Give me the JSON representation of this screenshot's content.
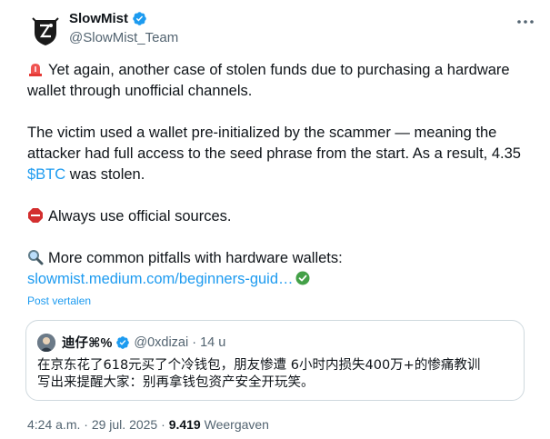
{
  "author": {
    "name": "SlowMist",
    "handle": "@SlowMist_Team"
  },
  "tweet": {
    "line1": "Yet again, another case of stolen funds due to purchasing a hardware wallet through unofficial channels.",
    "line2_pre": "The victim used a wallet pre-initialized by the scammer — meaning the attacker had full access to the seed phrase from the start. As a result, 4.35 ",
    "cashtag": "$BTC",
    "line2_post": " was stolen.",
    "line3": "Always use official sources.",
    "line4": "More common pitfalls with hardware wallets:",
    "link": "slowmist.medium.com/beginners-guid…"
  },
  "translate_label": "Post vertalen",
  "quote": {
    "name": "迪仔⌘%",
    "handle": "@0xdizai",
    "separator": "·",
    "time": "14 u",
    "text_line1": "在京东花了618元买了个冷钱包，朋友惨遭 6小时内损失400万+的惨痛教训",
    "text_line2": "写出来提醒大家：别再拿钱包资产安全开玩笑。"
  },
  "meta": {
    "time": "4:24 a.m.",
    "dot1": "·",
    "date": "29 jul. 2025",
    "dot2": "·",
    "views": "9.419",
    "views_label": "Weergaven"
  },
  "colors": {
    "accent": "#1d9bf0",
    "text": "#0f1419",
    "secondary": "#536471",
    "border": "#cfd9de"
  },
  "icons": [
    "slowmist-logo",
    "verified-badge-icon",
    "more-icon",
    "siren-emoji-icon",
    "stop-sign-emoji-icon",
    "magnifier-emoji-icon",
    "check-mark-emoji-icon"
  ]
}
